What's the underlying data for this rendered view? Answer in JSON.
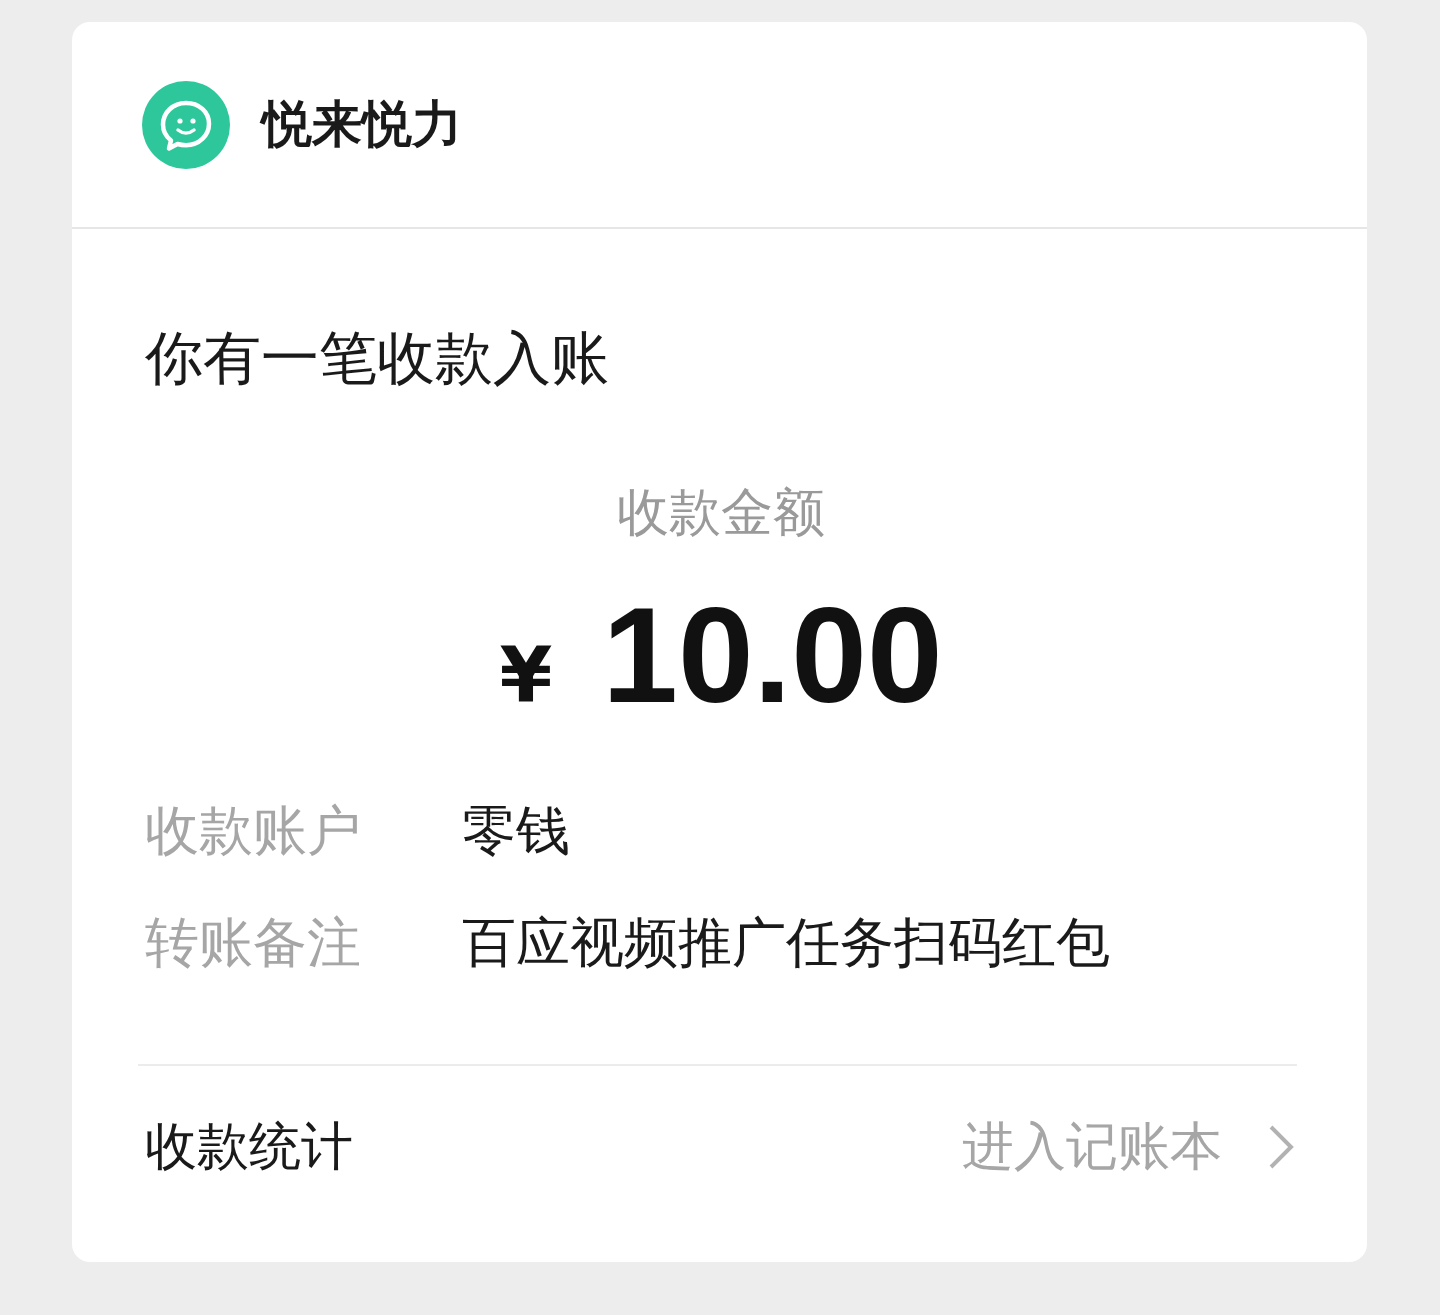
{
  "header": {
    "account_name": "悦来悦力"
  },
  "notice": {
    "title": "你有一笔收款入账",
    "amount_label": "收款金额",
    "currency": "¥",
    "amount": "10.00"
  },
  "details": [
    {
      "label": "收款账户",
      "value": "零钱"
    },
    {
      "label": "转账备注",
      "value": "百应视频推广任务扫码红包"
    }
  ],
  "footer": {
    "label": "收款统计",
    "link": "进入记账本"
  }
}
